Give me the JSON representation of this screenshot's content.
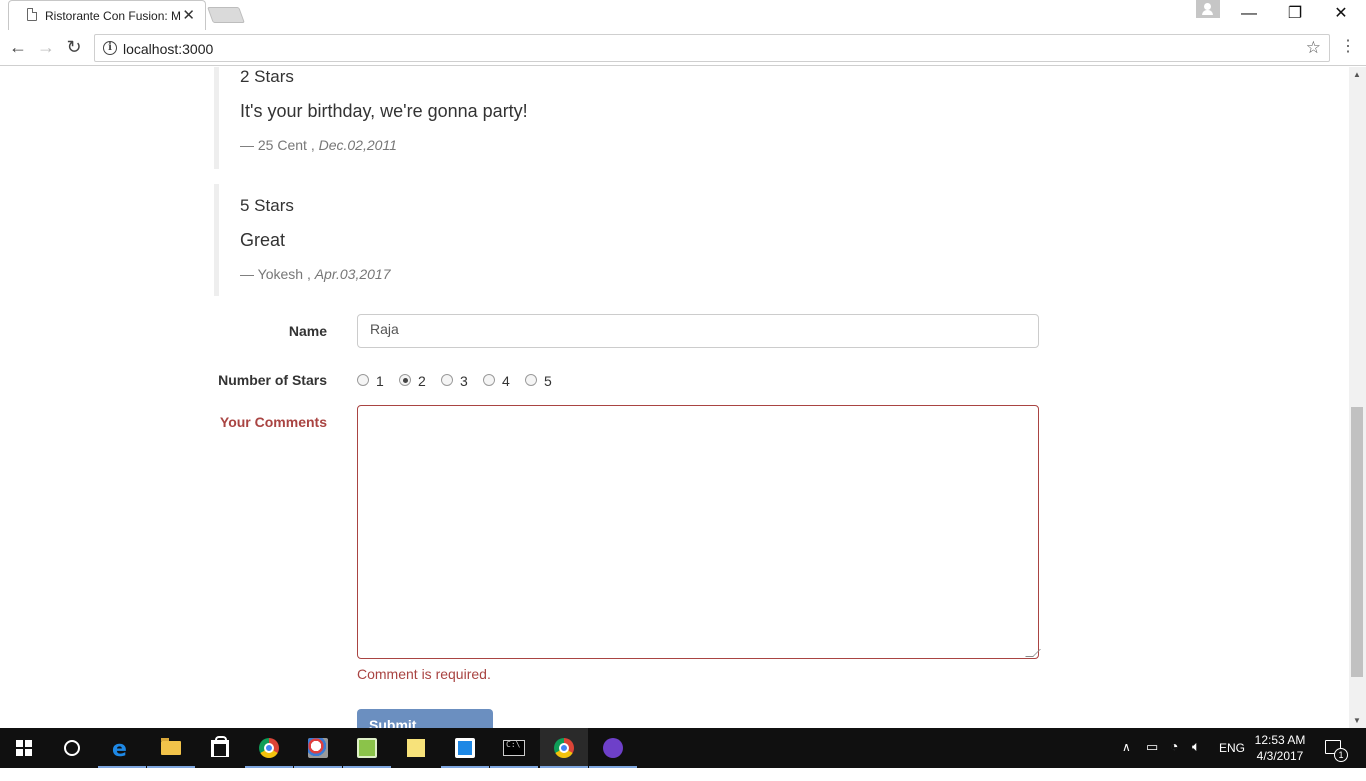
{
  "browser": {
    "tab_title": "Ristorante Con Fusion: M",
    "tab_close": "✕",
    "url": "localhost:3000",
    "window_controls": {
      "minimize": "—",
      "maximize": "❐",
      "close": "✕"
    }
  },
  "comments": [
    {
      "stars": "2 Stars",
      "text": "It's your birthday, we're gonna party!",
      "author": "— 25 Cent ,",
      "date": "Dec.02,2011"
    },
    {
      "stars": "5 Stars",
      "text": "Great",
      "author": "— Yokesh ,",
      "date": "Apr.03,2017"
    }
  ],
  "form": {
    "name_label": "Name",
    "name_value": "Raja",
    "stars_label": "Number of Stars",
    "star_options": [
      "1",
      "2",
      "3",
      "4",
      "5"
    ],
    "selected_star": "2",
    "comments_label": "Your Comments",
    "comments_value": "",
    "error_text": "Comment is required.",
    "submit_label": "Submit Comment"
  },
  "taskbar": {
    "language": "ENG",
    "time": "12:53 AM",
    "date": "4/3/2017",
    "notification_count": "1",
    "icons": [
      "windows-start-icon",
      "cortana-icon",
      "edge-icon",
      "file-explorer-icon",
      "store-icon",
      "chrome-icon",
      "paint-icon",
      "notepad-plus-icon",
      "sticky-notes-icon",
      "pin-app-icon",
      "terminal-icon",
      "chrome-active-icon",
      "github-desktop-icon"
    ]
  },
  "colors": {
    "error": "#a94442",
    "submit_button": "#6b8fc0",
    "taskbar": "#101010"
  }
}
